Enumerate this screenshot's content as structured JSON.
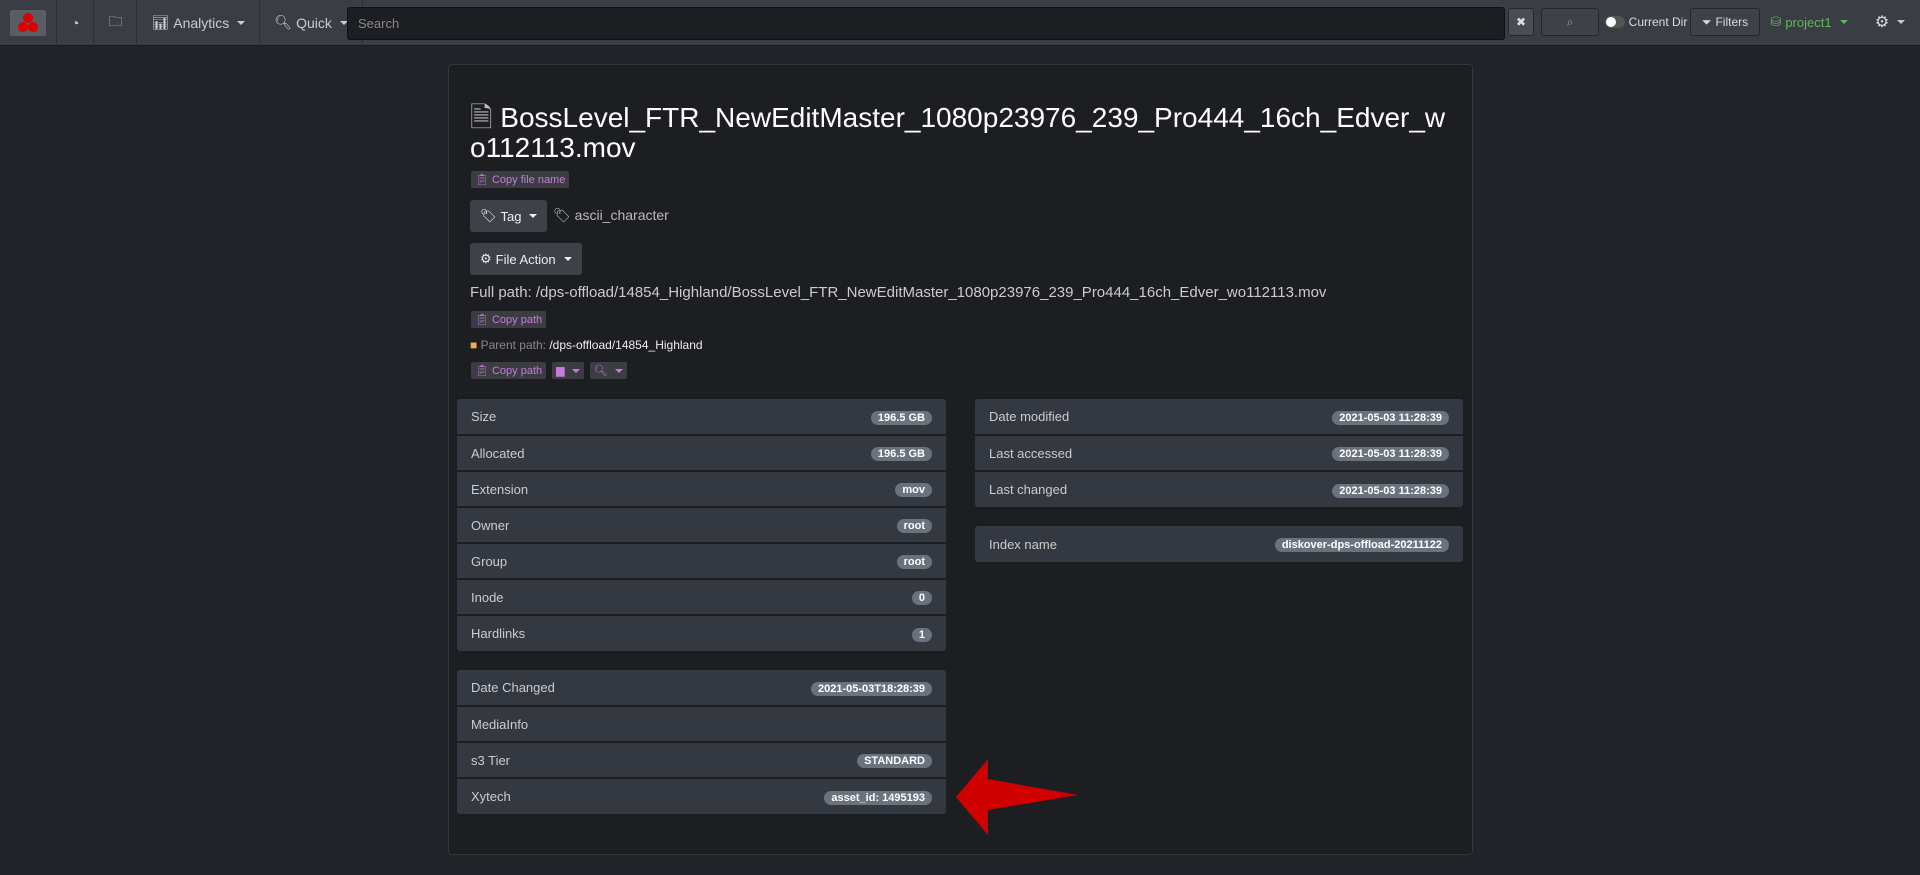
{
  "nav": {
    "analytics": "Analytics",
    "quick": "Quick",
    "search_placeholder": "Search",
    "current_dir": "Current Dir",
    "filters": "Filters",
    "project": "project1"
  },
  "file": {
    "name": "BossLevel_FTR_NewEditMaster_1080p23976_239_Pro444_16ch_Edver_wo112113.mov",
    "copy_file_name": "Copy file name",
    "tag_button": "Tag",
    "tag": "ascii_character",
    "file_action": "File Action",
    "full_path_label": "Full path:",
    "full_path": "/dps-offload/14854_Highland/BossLevel_FTR_NewEditMaster_1080p23976_239_Pro444_16ch_Edver_wo112113.mov",
    "copy_path": "Copy path",
    "parent_path_label": "Parent path:",
    "parent_path": "/dps-offload/14854_Highland"
  },
  "left_table": [
    {
      "label": "Size",
      "value": "196.5 GB"
    },
    {
      "label": "Allocated",
      "value": "196.5 GB"
    },
    {
      "label": "Extension",
      "value": "mov"
    },
    {
      "label": "Owner",
      "value": "root"
    },
    {
      "label": "Group",
      "value": "root"
    },
    {
      "label": "Inode",
      "value": "0"
    },
    {
      "label": "Hardlinks",
      "value": "1"
    }
  ],
  "right_table": [
    {
      "label": "Date modified",
      "value": "2021-05-03 11:28:39"
    },
    {
      "label": "Last accessed",
      "value": "2021-05-03 11:28:39"
    },
    {
      "label": "Last changed",
      "value": "2021-05-03 11:28:39"
    }
  ],
  "index_table": [
    {
      "label": "Index name",
      "value": "diskover-dps-offload-20211122"
    }
  ],
  "meta_table": [
    {
      "label": "Date Changed",
      "value": "2021-05-03T18:28:39"
    },
    {
      "label": "MediaInfo",
      "value": ""
    },
    {
      "label": "s3 Tier",
      "value": "STANDARD"
    },
    {
      "label": "Xytech",
      "value": "asset_id: 1495193"
    }
  ],
  "colors": {
    "accent_purple": "#c57bdc",
    "project_green": "#5cb85c",
    "arrow_red": "#d00000"
  }
}
